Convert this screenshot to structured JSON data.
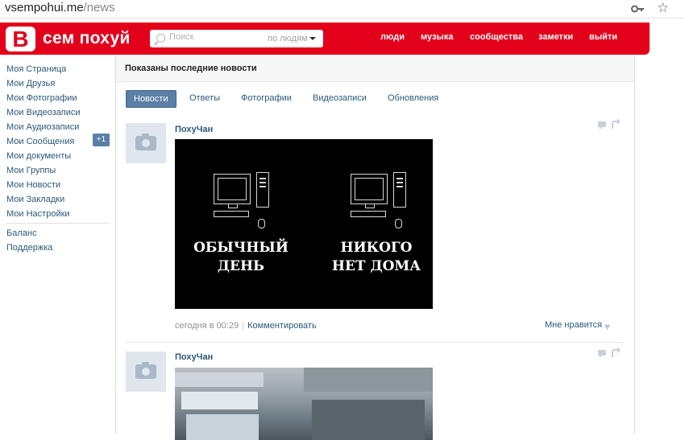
{
  "browser": {
    "url_host": "vsempohui.me",
    "url_path": "/news"
  },
  "header": {
    "logo_letter": "В",
    "logo_text": "сем похуй",
    "search_placeholder": "Поиск",
    "search_scope": "по людям",
    "nav": [
      "люди",
      "музыка",
      "сообщества",
      "заметки",
      "выйти"
    ]
  },
  "sidebar": {
    "items": [
      "Моя Страница",
      "Мои Друзья",
      "Мои Фотографии",
      "Мои Видеозаписи",
      "Мои Аудиозаписи",
      "Мои Сообщения",
      "Мои документы",
      "Мои Группы",
      "Мои Новости",
      "Мои Закладки",
      "Мои Настройки"
    ],
    "messages_badge": "+1",
    "extra": [
      "Баланс",
      "Поддержка"
    ]
  },
  "main": {
    "title": "Показаны последние новости",
    "tabs": [
      "Новости",
      "Ответы",
      "Фотографии",
      "Видеозаписи",
      "Обновления"
    ],
    "active_tab": 0,
    "posts": [
      {
        "author": "ПохуЧан",
        "meme_left": "ОБЫЧНЫЙ\nДЕНЬ",
        "meme_right": "НИКОГО\nНЕТ ДОМА",
        "time": "сегодня в 00:29",
        "separator": "|",
        "comment_label": "Комментировать",
        "like_label": "Мне нравится"
      },
      {
        "author": "ПохуЧан"
      }
    ]
  }
}
